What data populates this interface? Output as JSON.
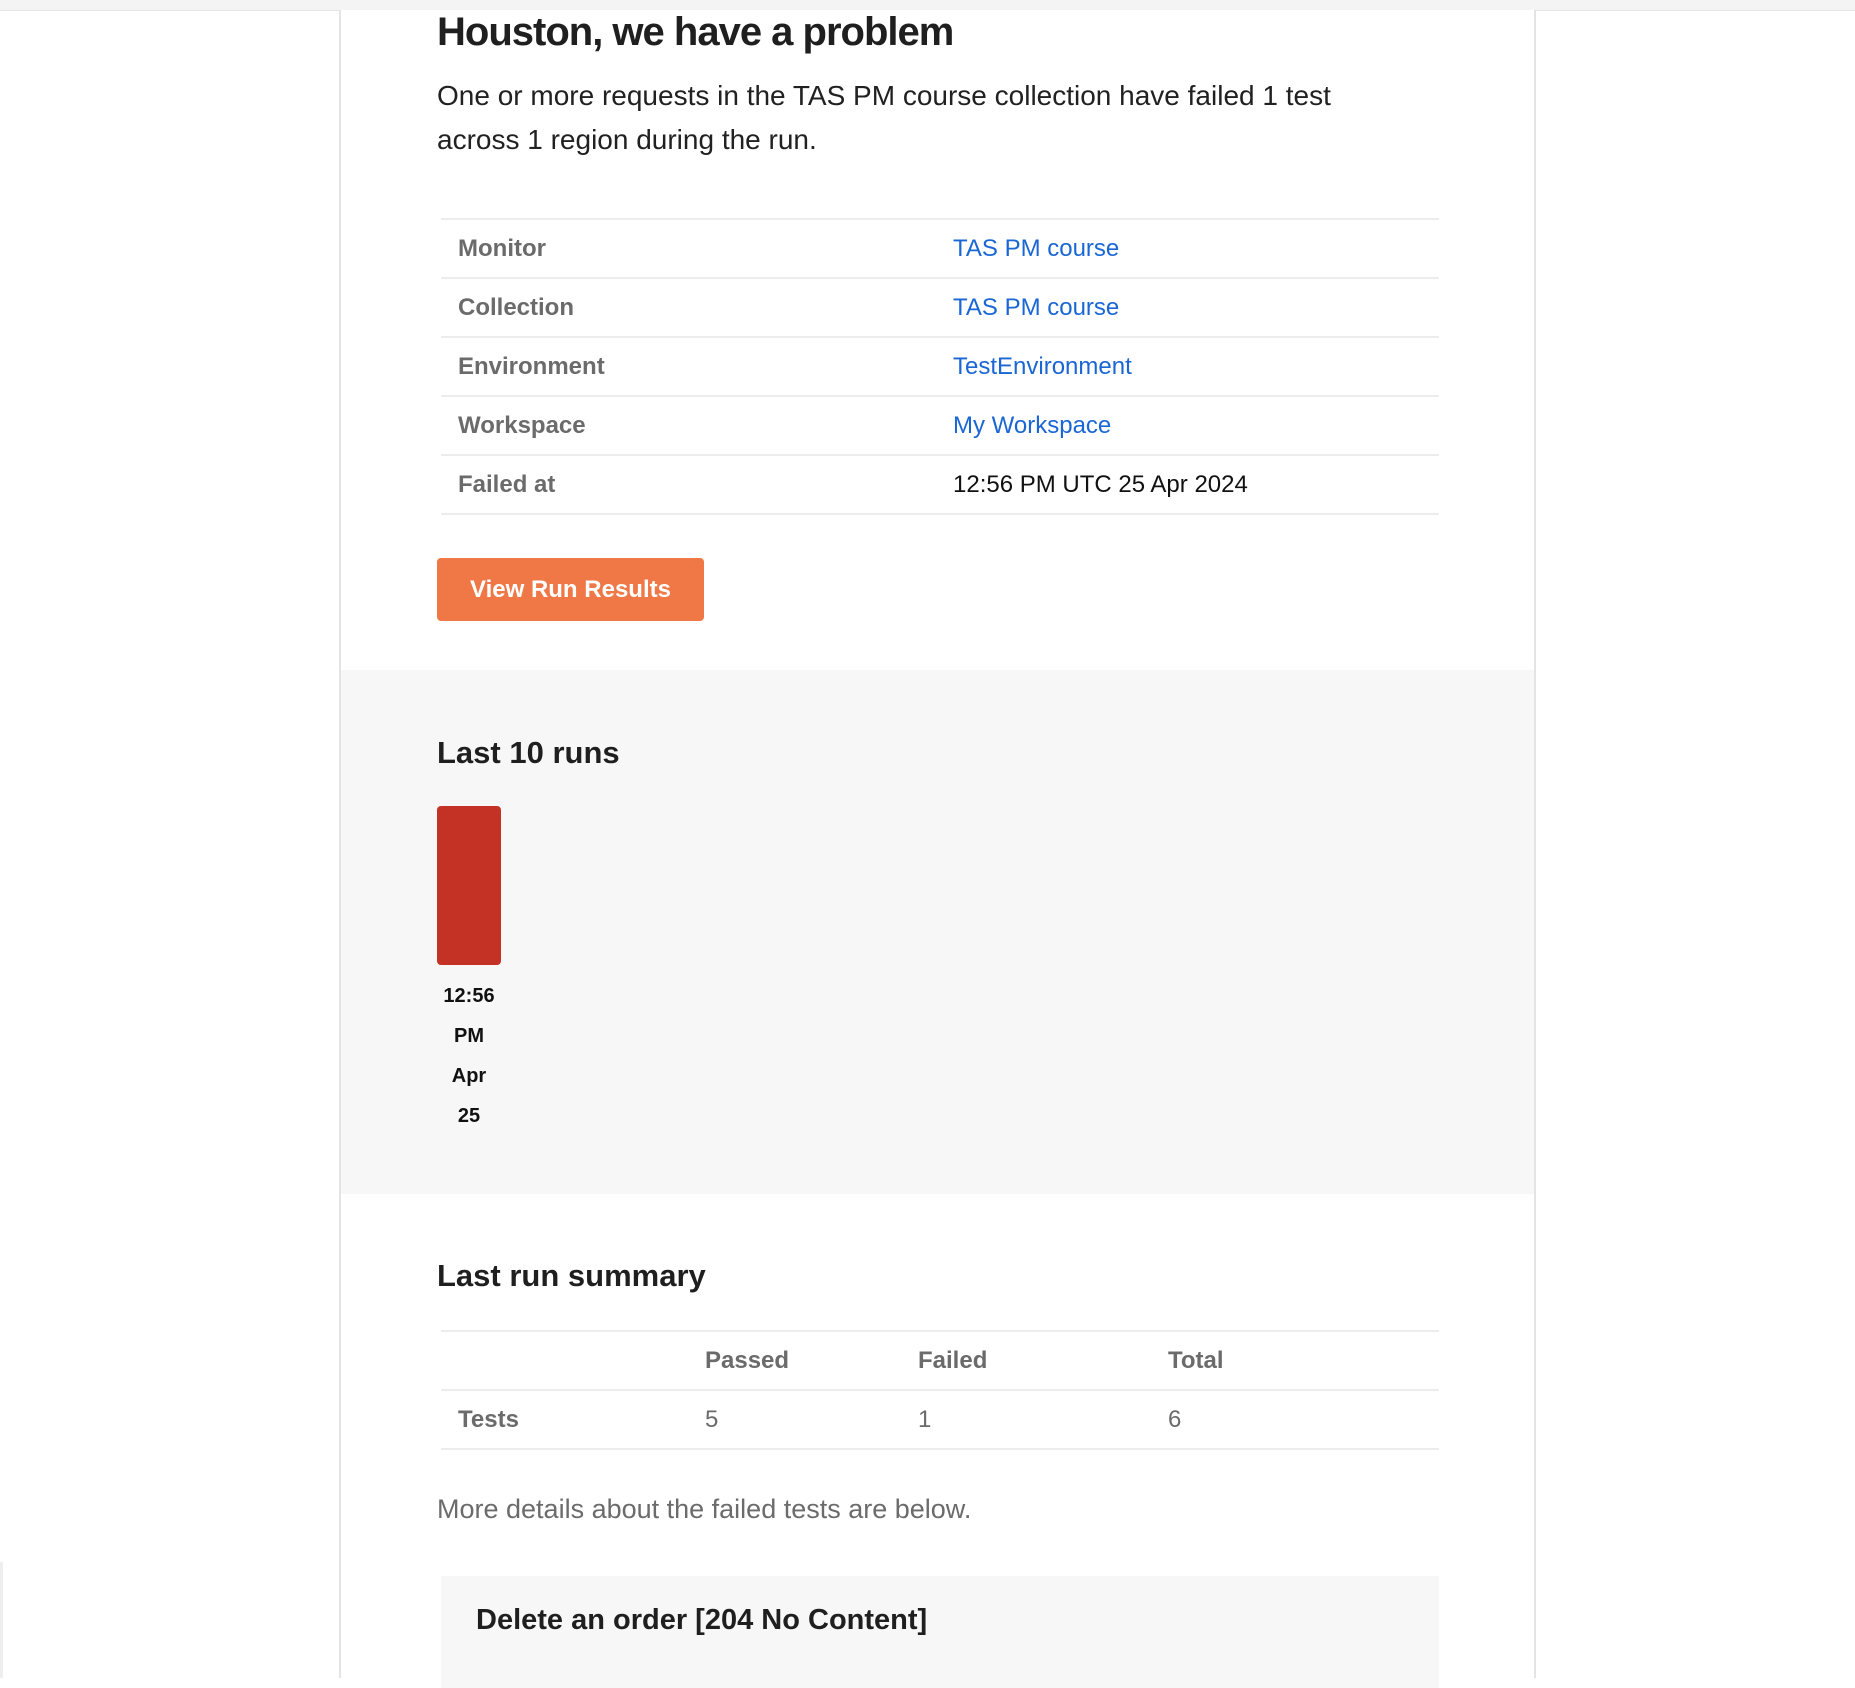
{
  "alert": {
    "headline": "Houston, we have a problem",
    "intro": "One or more requests in the TAS PM course collection have failed 1 test across 1 region during the run."
  },
  "details": {
    "rows": [
      {
        "label": "Monitor",
        "value": "TAS PM course",
        "link": true
      },
      {
        "label": "Collection",
        "value": "TAS PM course",
        "link": true
      },
      {
        "label": "Environment",
        "value": "TestEnvironment",
        "link": true
      },
      {
        "label": "Workspace",
        "value": "My Workspace",
        "link": true
      },
      {
        "label": "Failed at",
        "value": "12:56 PM UTC 25 Apr 2024",
        "link": false
      }
    ]
  },
  "actions": {
    "view_results_label": "View Run Results"
  },
  "last_runs": {
    "title": "Last 10 runs",
    "runs": [
      {
        "status": "failed",
        "color": "#c43226",
        "time": "12:56",
        "ampm": "PM",
        "month": "Apr",
        "day": "25"
      }
    ]
  },
  "summary": {
    "title": "Last run summary",
    "columns": [
      "",
      "Passed",
      "Failed",
      "Total"
    ],
    "rows": [
      {
        "label": "Tests",
        "passed": "5",
        "failed": "1",
        "total": "6"
      }
    ],
    "note": "More details about the failed tests are below."
  },
  "failed_tests": {
    "items": [
      {
        "title": "Delete an order [204 No Content]"
      }
    ]
  },
  "colors": {
    "accent_button": "#ef7846",
    "link": "#1a66d4",
    "failed_run": "#c43226"
  }
}
